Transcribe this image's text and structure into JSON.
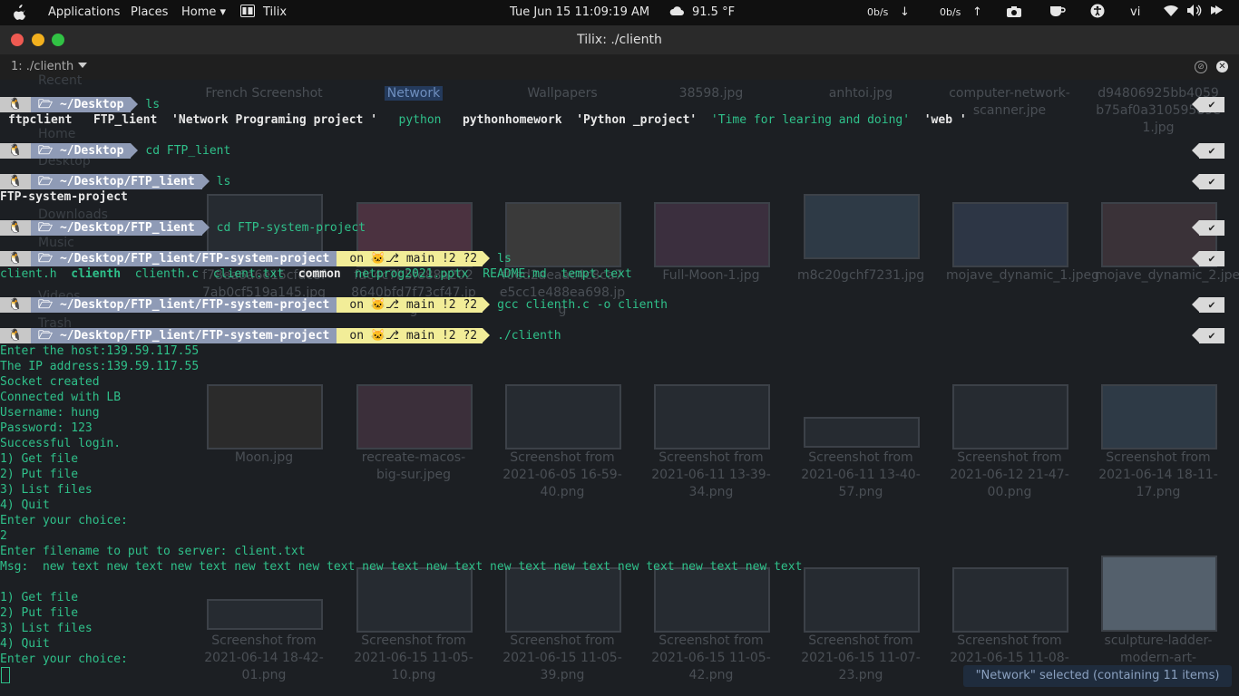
{
  "topbar": {
    "apps": "Applications",
    "places": "Places",
    "home": "Home ▾",
    "active_app": "Tilix",
    "clock": "Tue Jun 15  11:09:19 AM",
    "weather": "91.5 °F",
    "down_rate": "0b/s",
    "up_rate": "0b/s",
    "keyboard": "vi"
  },
  "window": {
    "title": "Tilix: ./clienth",
    "session": "1: ./clienth"
  },
  "file_manager": {
    "sidebar": [
      "Recent",
      "Home",
      "Desktop",
      "Downloads",
      "Music",
      "Videos",
      "Trash"
    ],
    "row0": [
      "French Screenshot",
      "Network",
      "Wallpapers",
      "38598.jpg",
      "anhtoi.jpg",
      "computer-network-scanner.jpe",
      "d94806925bb4059b75af0a31059589e1.jpg"
    ],
    "row1": [
      "f78ea6a6e15cfdc8f7ab0cf519a145.jpg",
      "fdc4c7b5fe88a2028640bfd7f73cf47.jpg",
      "f0ed2aeaac4c8ca7e5cc1e488ea698.jpg",
      "Full-Moon-1.jpg",
      "m8c20gchf7231.jpg",
      "mojave_dynamic_1.jpeg",
      "mojave_dynamic_2.jpeg"
    ],
    "row2": [
      "Moon.jpg",
      "recreate-macos-big-sur.jpeg",
      "Screenshot from 2021-06-05 16-59-40.png",
      "Screenshot from 2021-06-11 13-39-34.png",
      "Screenshot from 2021-06-11 13-40-57.png",
      "Screenshot from 2021-06-12 21-47-00.png",
      "Screenshot from 2021-06-14 18-11-17.png"
    ],
    "row3": [
      "Screenshot from 2021-06-14 18-42-01.png",
      "Screenshot from 2021-06-15 11-05-10.png",
      "Screenshot from 2021-06-15 11-05-39.png",
      "Screenshot from 2021-06-15 11-05-42.png",
      "Screenshot from 2021-06-15 11-07-23.png",
      "Screenshot from 2021-06-15 11-08-",
      "sculpture-ladder-modern-art-child.jpg"
    ],
    "status": "\"Network\" selected  (containing 11 items)"
  },
  "terminal": {
    "prompts": [
      {
        "dir": "~/Desktop",
        "git": "",
        "cmd": "ls"
      },
      {
        "dir": "~/Desktop",
        "git": "",
        "cmd": "cd FTP_lient"
      },
      {
        "dir": "~/Desktop/FTP_lient",
        "git": "",
        "cmd": "ls"
      },
      {
        "dir": "~/Desktop/FTP_lient",
        "git": "",
        "cmd": "cd FTP-system-project"
      },
      {
        "dir": "~/Desktop/FTP_lient/FTP-system-project",
        "git": "on 🐱⎇ main !2 ?2",
        "cmd": "ls"
      },
      {
        "dir": "~/Desktop/FTP_lient/FTP-system-project",
        "git": "on 🐱⎇ main !2 ?2",
        "cmd": "gcc clienth.c -o clienth"
      },
      {
        "dir": "~/Desktop/FTP_lient/FTP-system-project",
        "git": "on 🐱⎇ main !2 ?2",
        "cmd": "./clienth"
      }
    ],
    "ls_desktop": {
      "ftpclient": "ftpclient",
      "ftp_lient": "FTP_lient",
      "network": "'Network Programing project '",
      "python": "python",
      "pythonhomework": "pythonhomework",
      "python_project": "'Python _project'",
      "time": "'Time for learing and doing'",
      "web": "'web '"
    },
    "ls_ftp": "FTP-system-project",
    "ls_project": {
      "client_h": "client.h",
      "clienth": "clienth",
      "clienth_c": "clienth.c",
      "client_txt": "client.txt",
      "common": "common",
      "netprog": "netprog2021.pptx",
      "readme": "README.md",
      "tempt": "tempt.text"
    },
    "output": [
      "Enter the host:139.59.117.55",
      "The IP address:139.59.117.55",
      "Socket created",
      "Connected with LB",
      "Username: hung",
      "Password: 123",
      "Successful login.",
      "1) Get file",
      "2) Put file",
      "3) List files",
      "4) Quit",
      "Enter your choice:",
      "2",
      "Enter filename to put to server: client.txt",
      "Msg:  new text new text new text new text new text new text new text new text new text new text new text new text",
      "",
      "1) Get file",
      "2) Put file",
      "3) List files",
      "4) Quit",
      "Enter your choice:"
    ],
    "ok_mark": "✔"
  }
}
